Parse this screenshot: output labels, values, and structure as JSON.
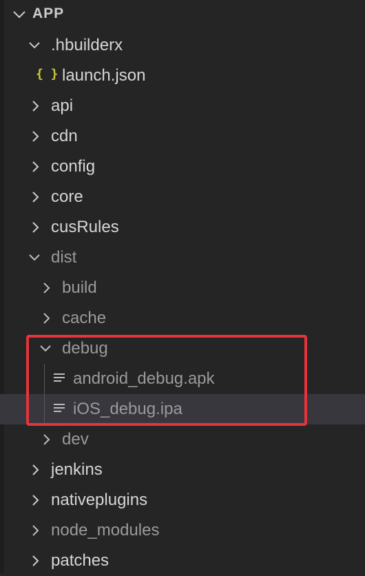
{
  "explorer": {
    "section_title": "APP",
    "items": [
      {
        "label": ".hbuilderx",
        "type": "folder",
        "expanded": true,
        "level": 1,
        "icon": "chevron-down-icon"
      },
      {
        "label": "launch.json",
        "type": "file",
        "level": 2,
        "icon": "json-braces-icon",
        "icon_glyph": "{ }",
        "icon_color": "#cbcb41"
      },
      {
        "label": "api",
        "type": "folder",
        "expanded": false,
        "level": 1,
        "icon": "chevron-right-icon"
      },
      {
        "label": "cdn",
        "type": "folder",
        "expanded": false,
        "level": 1,
        "icon": "chevron-right-icon"
      },
      {
        "label": "config",
        "type": "folder",
        "expanded": false,
        "level": 1,
        "icon": "chevron-right-icon"
      },
      {
        "label": "core",
        "type": "folder",
        "expanded": false,
        "level": 1,
        "icon": "chevron-right-icon"
      },
      {
        "label": "cusRules",
        "type": "folder",
        "expanded": false,
        "level": 1,
        "icon": "chevron-right-icon"
      },
      {
        "label": "dist",
        "type": "folder",
        "expanded": true,
        "level": 1,
        "icon": "chevron-down-icon",
        "dimmed": true
      },
      {
        "label": "build",
        "type": "folder",
        "expanded": false,
        "level": 2,
        "icon": "chevron-right-icon",
        "dimmed": true
      },
      {
        "label": "cache",
        "type": "folder",
        "expanded": false,
        "level": 2,
        "icon": "chevron-right-icon",
        "dimmed": true
      },
      {
        "label": "debug",
        "type": "folder",
        "expanded": true,
        "level": 2,
        "icon": "chevron-down-icon",
        "dimmed": true
      },
      {
        "label": "android_debug.apk",
        "type": "file",
        "level": 3,
        "icon": "text-file-icon",
        "dimmed": true
      },
      {
        "label": "iOS_debug.ipa",
        "type": "file",
        "level": 3,
        "icon": "text-file-icon",
        "dimmed": true,
        "selected": true
      },
      {
        "label": "dev",
        "type": "folder",
        "expanded": false,
        "level": 2,
        "icon": "chevron-right-icon",
        "dimmed": true
      },
      {
        "label": "jenkins",
        "type": "folder",
        "expanded": false,
        "level": 1,
        "icon": "chevron-right-icon"
      },
      {
        "label": "nativeplugins",
        "type": "folder",
        "expanded": false,
        "level": 1,
        "icon": "chevron-right-icon"
      },
      {
        "label": "node_modules",
        "type": "folder",
        "expanded": false,
        "level": 1,
        "icon": "chevron-right-icon",
        "dimmed": true
      },
      {
        "label": "patches",
        "type": "folder",
        "expanded": false,
        "level": 1,
        "icon": "chevron-right-icon"
      }
    ]
  },
  "colors": {
    "background": "#252526",
    "selected_row": "#37373d",
    "highlight_border": "#e5343b",
    "json_icon": "#cbcb41",
    "text_bright": "#d6d6d6",
    "text_dim": "#9a9a9a"
  }
}
